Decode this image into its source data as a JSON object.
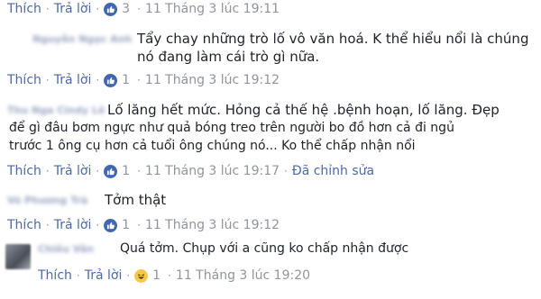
{
  "comments": [
    {
      "name": "Nguyễn Ngọc Anh",
      "lines": [
        "Tẩy chay những trò lố vô văn hoá. K thể hiểu nổi là chúng",
        "nó đang làm cái trò gì nữa."
      ],
      "action_like": "Thích",
      "action_reply": "Trả lời",
      "reaction": "like",
      "count": "1",
      "time": "11 Tháng 3 lúc 19:12"
    },
    {
      "name": "Thu Nga Cindy Lê",
      "lines": [
        "Lố lăng hết mức. Hỏng cả thế hệ .bệnh hoạn, lố lăng. Đẹp",
        "để gì đâu bơm ngực như quả bóng treo trên người bo đồ hơn cả đi ngủ",
        "trước 1 ông cụ hơn cả tuổi ông chúng nó... Ko thể chấp nhận nổi"
      ],
      "action_like": "Thích",
      "action_reply": "Trả lời",
      "reaction": "like",
      "count": "1",
      "time": "11 Tháng 3 lúc 19:17",
      "edited": "Đã chỉnh sửa"
    },
    {
      "name": "Võ Phương Trà",
      "lines": [
        "Tởm thật"
      ],
      "action_like": "Thích",
      "action_reply": "Trả lời",
      "reaction": "like",
      "count": "1",
      "time": "11 Tháng 3 lúc 19:12"
    },
    {
      "name": "Chiều Vân",
      "lines": [
        "Quá tởm. Chụp với a cũng ko chấp nhận được"
      ],
      "action_like": "Thích",
      "action_reply": "Trả lời",
      "reaction": "haha",
      "count": "1",
      "time": "11 Tháng 3 lúc 19:20"
    }
  ],
  "top_bar": {
    "action_like": "Thích",
    "action_reply": "Trả lời",
    "reaction": "like",
    "count": "3",
    "time": "11 Tháng 3 lúc 19:11"
  },
  "colors": {
    "link": "#4b6aa6",
    "meta": "#90949c",
    "like_icon": "#4267b2",
    "haha_icon": "#f7c94a",
    "text": "#1d2129"
  }
}
